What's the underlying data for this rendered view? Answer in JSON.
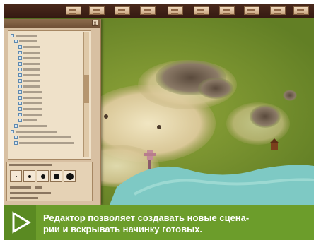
{
  "caption": {
    "line1": "Редактор позволяет создавать новые сцена-",
    "line2": "рии и вскрывать начинку готовых."
  },
  "editor": {
    "toolbar_buttons": [
      "map-tool-1",
      "map-tool-2",
      "map-tool-3",
      "map-tool-4",
      "map-tool-5",
      "map-tool-6",
      "map-tool-7",
      "map-tool-8",
      "map-tool-9",
      "map-tool-10"
    ],
    "close_glyph": "x"
  },
  "colors": {
    "caption_bg": "#6c9d2b",
    "panel_bg": "#d8c0a2",
    "grass": "#6f8b2b",
    "water": "#7ec9c4",
    "sand": "#e7d7ad"
  },
  "icons": [
    "close-icon",
    "play-triangle-icon",
    "brush-size-icon"
  ]
}
